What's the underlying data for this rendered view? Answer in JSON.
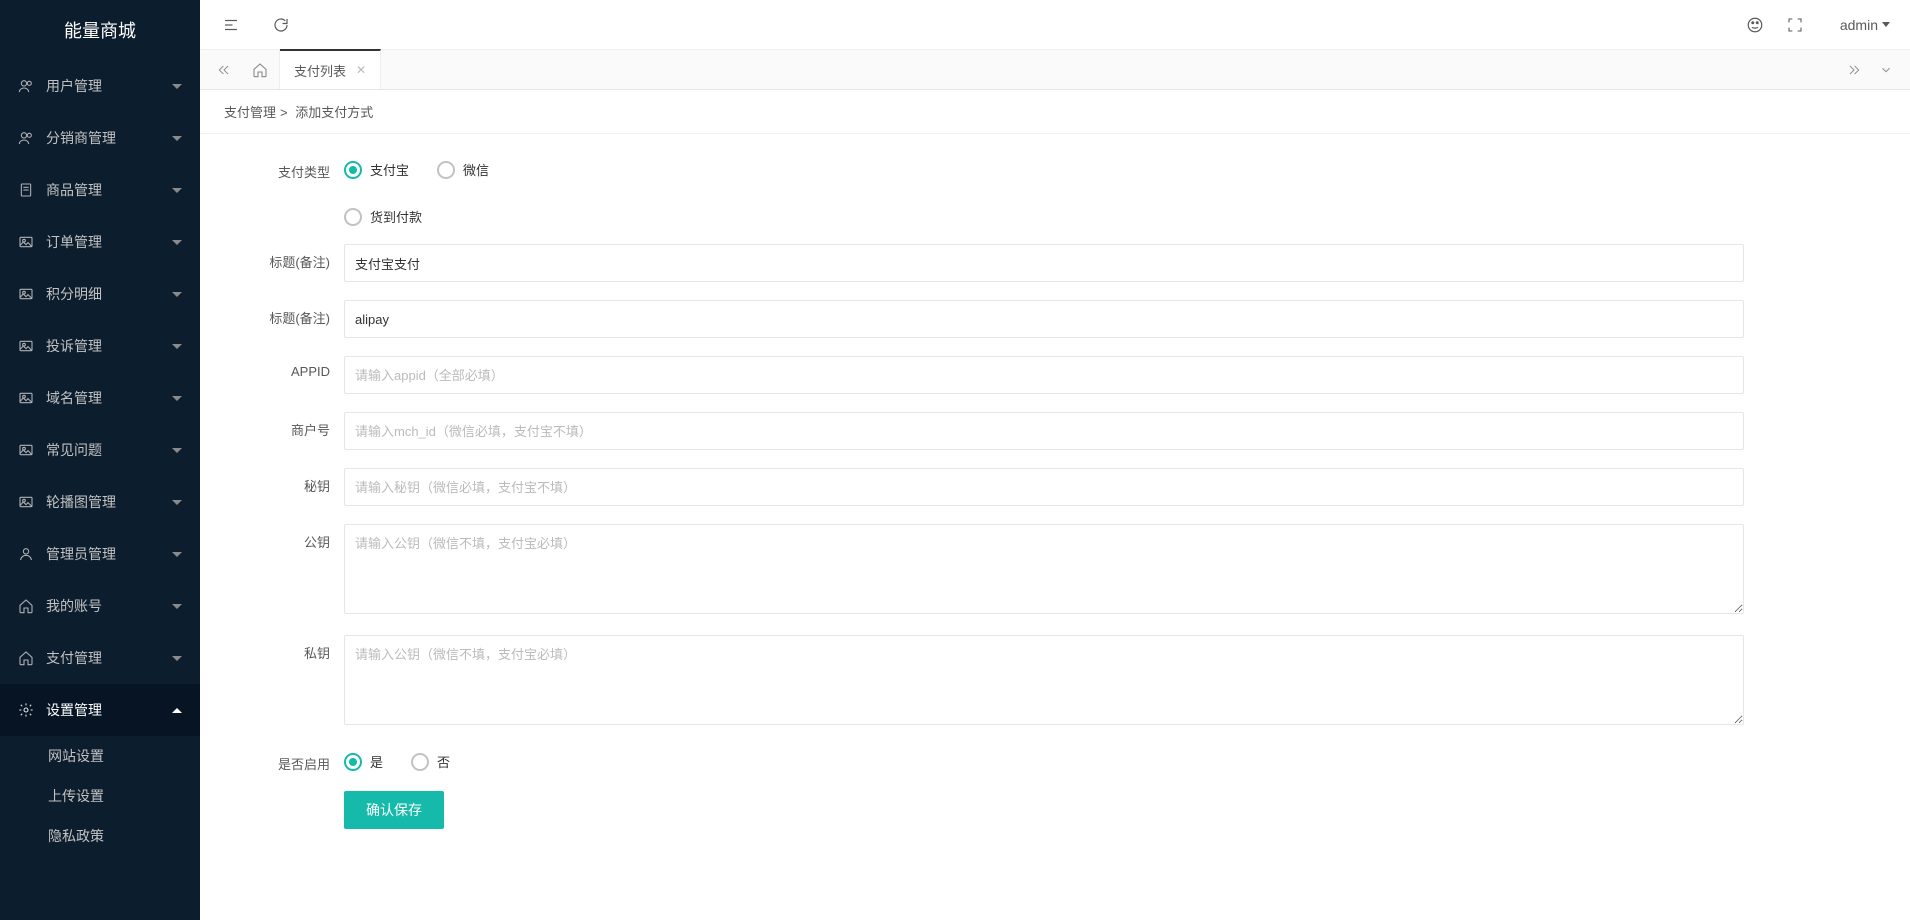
{
  "app_title": "能量商城",
  "user": {
    "name": "admin"
  },
  "sidebar": {
    "items": [
      {
        "icon": "users",
        "label": "用户管理"
      },
      {
        "icon": "users",
        "label": "分销商管理"
      },
      {
        "icon": "doc",
        "label": "商品管理"
      },
      {
        "icon": "image",
        "label": "订单管理"
      },
      {
        "icon": "image",
        "label": "积分明细"
      },
      {
        "icon": "image",
        "label": "投诉管理"
      },
      {
        "icon": "image",
        "label": "域名管理"
      },
      {
        "icon": "image",
        "label": "常见问题"
      },
      {
        "icon": "image",
        "label": "轮播图管理"
      },
      {
        "icon": "user",
        "label": "管理员管理"
      },
      {
        "icon": "home",
        "label": "我的账号"
      },
      {
        "icon": "home",
        "label": "支付管理"
      },
      {
        "icon": "gear",
        "label": "设置管理"
      }
    ],
    "settings_sub": [
      {
        "label": "网站设置"
      },
      {
        "label": "上传设置"
      },
      {
        "label": "隐私政策"
      }
    ]
  },
  "tabs": {
    "active": {
      "label": "支付列表"
    }
  },
  "breadcrumb": {
    "a": "支付管理",
    "b": "添加支付方式"
  },
  "form": {
    "pay_type": {
      "label": "支付类型",
      "options": [
        "支付宝",
        "微信",
        "货到付款"
      ],
      "selected": "支付宝"
    },
    "title1": {
      "label": "标题(备注)",
      "value": "支付宝支付"
    },
    "title2": {
      "label": "标题(备注)",
      "value": "alipay"
    },
    "appid": {
      "label": "APPID",
      "placeholder": "请输入appid（全部必填）",
      "value": ""
    },
    "mchid": {
      "label": "商户号",
      "placeholder": "请输入mch_id（微信必填，支付宝不填）",
      "value": ""
    },
    "secret": {
      "label": "秘钥",
      "placeholder": "请输入秘钥（微信必填，支付宝不填）",
      "value": ""
    },
    "public_key": {
      "label": "公钥",
      "placeholder": "请输入公钥（微信不填，支付宝必填）",
      "value": ""
    },
    "private_key": {
      "label": "私钥",
      "placeholder": "请输入公钥（微信不填，支付宝必填）",
      "value": ""
    },
    "enabled": {
      "label": "是否启用",
      "options": [
        "是",
        "否"
      ],
      "selected": "是"
    },
    "submit": "确认保存"
  }
}
